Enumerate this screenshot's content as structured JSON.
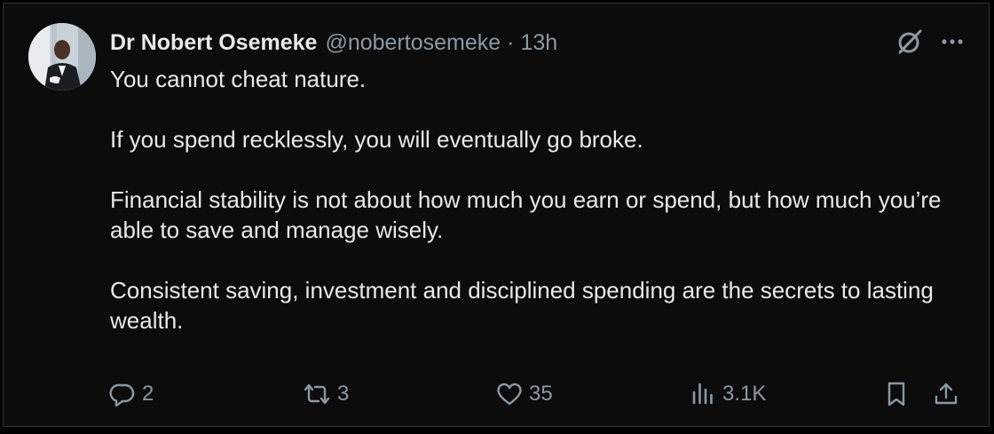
{
  "author": {
    "display_name": "Dr Nobert Osemeke",
    "handle": "@nobertosemeke",
    "separator": "·",
    "time": "13h"
  },
  "tweet": {
    "paragraphs": [
      "You cannot cheat nature.",
      "If you spend recklessly, you will eventually go broke.",
      "Financial stability is not about how much you earn or spend, but how much you’re able to save and manage wisely.",
      "Consistent saving, investment and disciplined spending are the secrets to lasting wealth."
    ]
  },
  "actions": {
    "replies": "2",
    "reposts": "3",
    "likes": "35",
    "views": "3.1K"
  },
  "icons": {
    "grok": "grok-icon",
    "more": "more-icon",
    "reply": "reply-icon",
    "repost": "repost-icon",
    "like": "like-icon",
    "views": "views-icon",
    "bookmark": "bookmark-icon",
    "share": "share-icon"
  },
  "colors": {
    "background": "#000000",
    "card": "#0c0c0c",
    "text": "#e7e9ea",
    "secondary": "#8b98a5",
    "border": "#2f3336"
  }
}
